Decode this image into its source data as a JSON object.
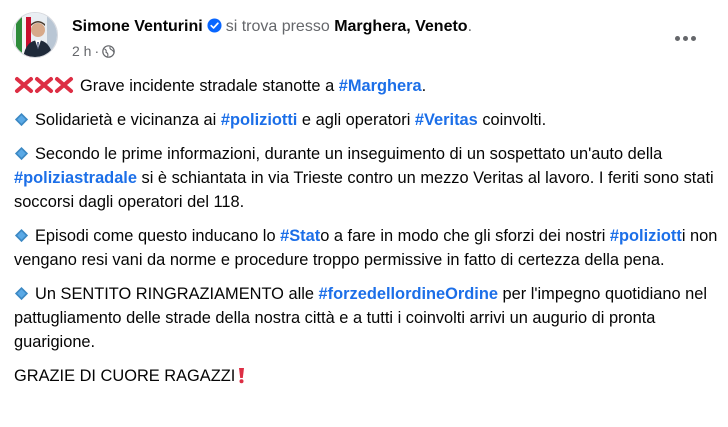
{
  "header": {
    "author": "Simone Venturini",
    "location_prefix": "si trova presso",
    "location": "Marghera, Veneto",
    "location_suffix": ".",
    "time": "2 h",
    "dot": "·"
  },
  "colors": {
    "hashtag": "#1c6fe8",
    "muted": "#65676b",
    "verified": "#0866ff",
    "red_x": "#dd2e44",
    "diamond": "#3b88c3"
  },
  "icons": {
    "verified": "verified-badge-icon",
    "globe": "globe-icon",
    "more": "more-options-icon",
    "cross": "red-cross-mark-icon",
    "diamond": "blue-diamond-icon",
    "exclamation": "red-exclamation-icon"
  },
  "post": {
    "p1": {
      "t1": "Grave incidente stradale stanotte a ",
      "h1": "#Marghera",
      "t2": "."
    },
    "p2": {
      "t1": "Solidarietà e vicinanza ai ",
      "h1": "#poliziotti",
      "t2": " e agli operatori ",
      "h2": "#Veritas",
      "t3": " coinvolti."
    },
    "p3": {
      "t1": "Secondo le prime informazioni, durante un inseguimento di un sospettato un'auto della ",
      "h1": "#poliziastradale",
      "t2": " si è schiantata in via Trieste contro un mezzo Veritas al lavoro. I feriti sono stati soccorsi dagli operatori del 118."
    },
    "p4": {
      "t1": "Episodi come questo inducano lo ",
      "h1": "#Stat",
      "t2": "o a fare in modo che gli sforzi dei nostri ",
      "h2": "#poliziott",
      "t3": "i non vengano resi vani da norme e procedure troppo permissive in fatto di certezza della pena."
    },
    "p5": {
      "t1": "Un SENTITO RINGRAZIAMENTO alle ",
      "h1": "#forzedellordineOrdine",
      "t2": " per l'impegno quotidiano nel pattugliamento delle strade della nostra città e a tutti i coinvolti arrivi un augurio di pronta guarigione."
    },
    "p6": {
      "t1": "GRAZIE DI CUORE RAGAZZI"
    }
  }
}
